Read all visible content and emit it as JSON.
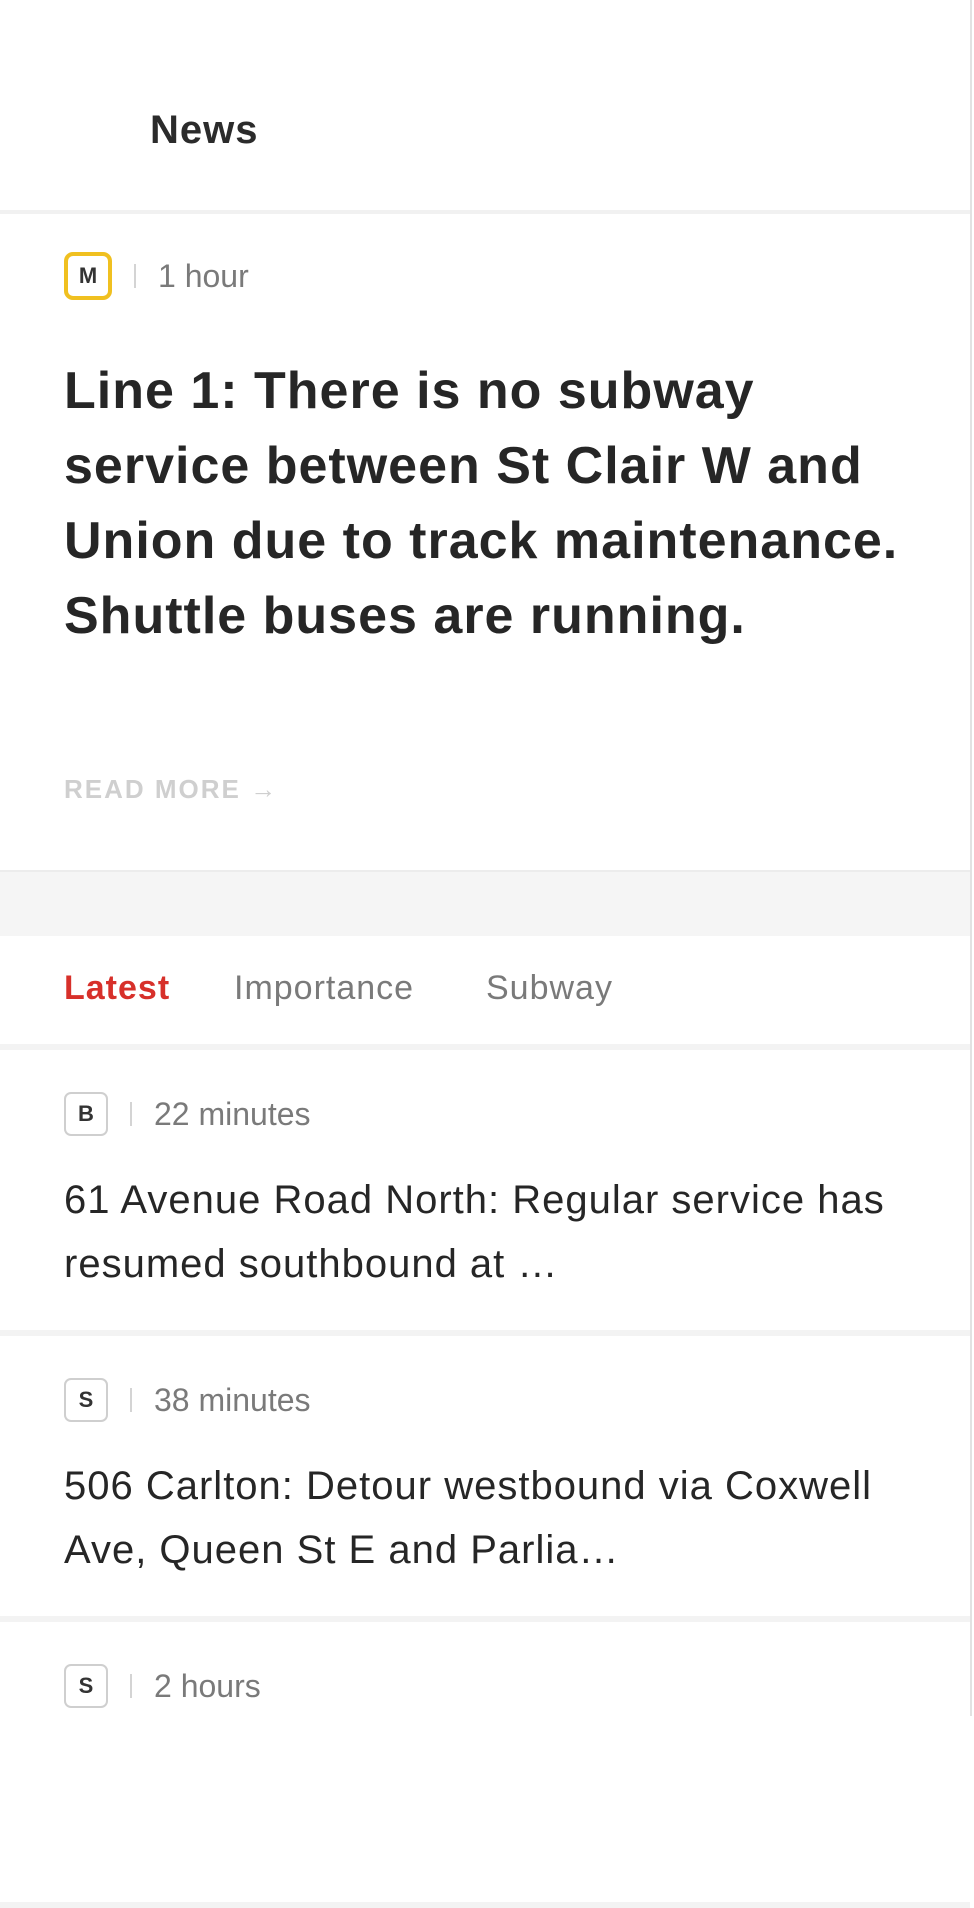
{
  "header": {
    "title": "News"
  },
  "featured": {
    "badge": "M",
    "badge_color": "#f0c020",
    "time": "1 hour",
    "headline": "Line 1: There is no subway service between St Clair W and Union due to track maintenance. Shuttle buses are running.",
    "read_more": "READ MORE →"
  },
  "tabs": [
    {
      "label": "Latest",
      "active": true
    },
    {
      "label": "Importance",
      "active": false
    },
    {
      "label": "Subway",
      "active": false
    }
  ],
  "accent_color": "#d7302a",
  "items": [
    {
      "badge": "B",
      "time": "22 minutes",
      "headline": "61 Avenue Road North: Regular service has resumed southbound at …"
    },
    {
      "badge": "S",
      "time": "38 minutes",
      "headline": "506 Carlton: Detour westbound via Coxwell Ave, Queen St E and Parlia…"
    },
    {
      "badge": "S",
      "time": "2 hours",
      "headline": ""
    }
  ]
}
